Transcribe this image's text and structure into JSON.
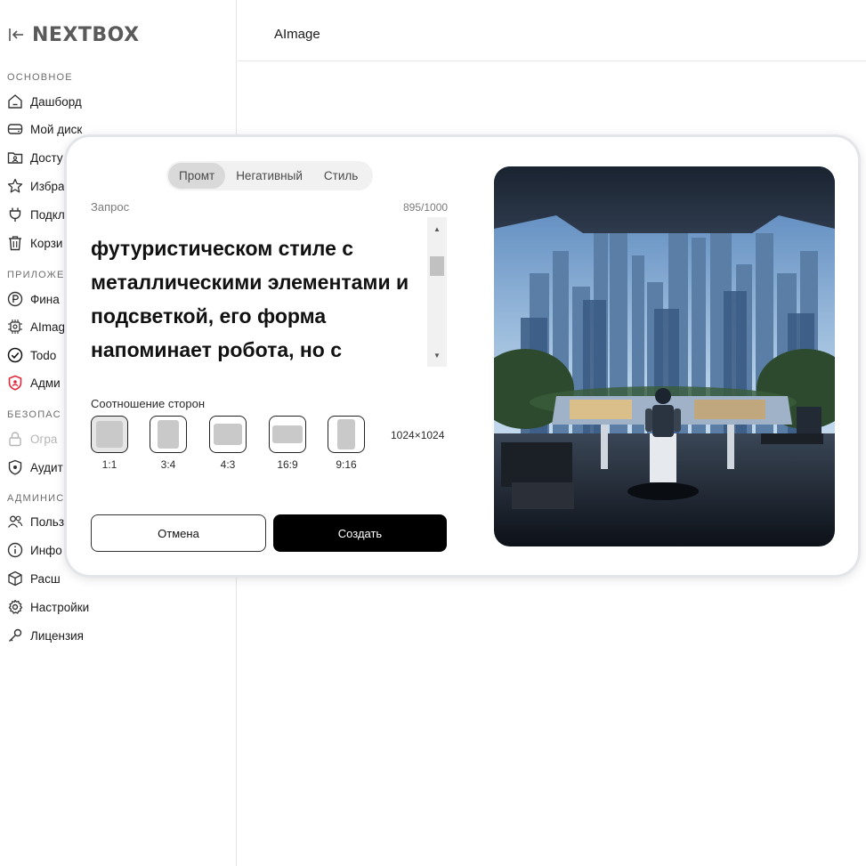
{
  "brand": {
    "name": "NEXTBOX"
  },
  "header": {
    "title": "AImage"
  },
  "sidebar": {
    "sections": [
      {
        "title": "ОСНОВНОЕ"
      },
      {
        "title": "ПРИЛОЖЕ"
      },
      {
        "title": "БЕЗОПАС"
      },
      {
        "title": "АДМИНИС"
      }
    ],
    "items": [
      {
        "label": "Дашборд",
        "icon": "home-icon"
      },
      {
        "label": "Мой диск",
        "icon": "drive-icon"
      },
      {
        "label": "Досту",
        "icon": "shared-folder-icon"
      },
      {
        "label": "Избра",
        "icon": "star-icon"
      },
      {
        "label": "Подкл",
        "icon": "plug-icon"
      },
      {
        "label": "Корзи",
        "icon": "trash-icon"
      },
      {
        "label": "Фина",
        "icon": "ruble-icon"
      },
      {
        "label": "AImag",
        "icon": "ai-chip-icon"
      },
      {
        "label": "Todo",
        "icon": "check-circle-icon"
      },
      {
        "label": "Адми",
        "icon": "shield-admin-icon"
      },
      {
        "label": "Огра",
        "icon": "lock-icon"
      },
      {
        "label": "Аудит",
        "icon": "shield-check-icon"
      },
      {
        "label": "Польз",
        "icon": "users-icon"
      },
      {
        "label": "Инфо",
        "icon": "info-icon"
      },
      {
        "label": "Расш",
        "icon": "box-icon"
      },
      {
        "label": "Настройки",
        "icon": "gear-icon"
      },
      {
        "label": "Лицензия",
        "icon": "key-icon"
      }
    ]
  },
  "modal": {
    "tabs": [
      {
        "label": "Промт",
        "active": true
      },
      {
        "label": "Негативный",
        "active": false
      },
      {
        "label": "Стиль",
        "active": false
      }
    ],
    "prompt": {
      "label": "Запрос",
      "counter": "895/1000",
      "text": "· ·\nфутуристическом стиле с металлическими элементами и подсветкой, его форма напоминает робота, но с"
    },
    "aspect": {
      "label": "Соотношение сторон",
      "options": [
        {
          "label": "1:1",
          "selected": true
        },
        {
          "label": "3:4",
          "selected": false
        },
        {
          "label": "4:3",
          "selected": false
        },
        {
          "label": "16:9",
          "selected": false
        },
        {
          "label": "9:16",
          "selected": false
        }
      ],
      "resolution": "1024×1024"
    },
    "buttons": {
      "cancel": "Отмена",
      "create": "Создать"
    }
  },
  "colors": {
    "primary_button": "#000000",
    "admin_icon": "#e0283a"
  }
}
